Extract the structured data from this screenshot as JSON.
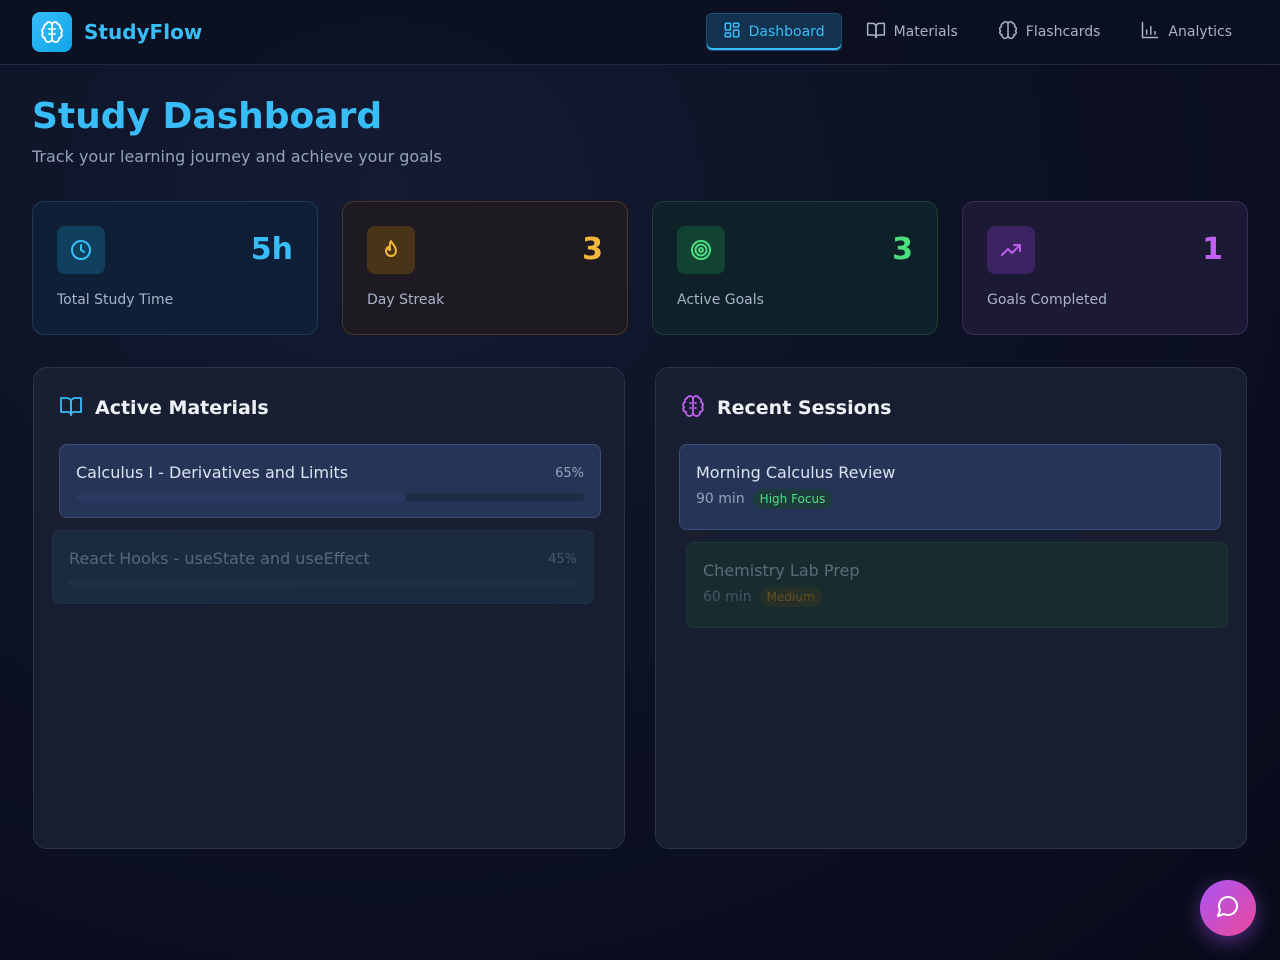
{
  "app": {
    "name": "StudyFlow",
    "logo_icon": "brain-icon",
    "accent": "#38bdf8"
  },
  "nav": {
    "items": [
      {
        "label": "Dashboard",
        "icon": "dashboard-icon",
        "active": true
      },
      {
        "label": "Materials",
        "icon": "book-icon",
        "active": false
      },
      {
        "label": "Flashcards",
        "icon": "brain-icon",
        "active": false
      },
      {
        "label": "Analytics",
        "icon": "bar-chart-icon",
        "active": false
      }
    ]
  },
  "page": {
    "title": "Study Dashboard",
    "subtitle": "Track your learning journey and achieve your goals"
  },
  "stats": [
    {
      "value": "5h",
      "label": "Total Study Time",
      "icon": "clock-icon",
      "color": "#38bdf8"
    },
    {
      "value": "3",
      "label": "Day Streak",
      "icon": "flame-icon",
      "color": "#f5b73a"
    },
    {
      "value": "3",
      "label": "Active Goals",
      "icon": "target-icon",
      "color": "#4ade80"
    },
    {
      "value": "1",
      "label": "Goals Completed",
      "icon": "trending-up-icon",
      "color": "#c060f0"
    }
  ],
  "materials": {
    "title": "Active Materials",
    "icon": "book-open-icon",
    "items": [
      {
        "name": "Calculus I - Derivatives and Limits",
        "percent_label": "65%",
        "progress": 0.65
      },
      {
        "name": "React Hooks - useState and useEffect",
        "percent_label": "45%",
        "progress": 0.45
      }
    ]
  },
  "sessions": {
    "title": "Recent Sessions",
    "icon": "brain-icon",
    "items": [
      {
        "name": "Morning Calculus Review",
        "duration": "90 min",
        "focus": "High Focus"
      },
      {
        "name": "Chemistry Lab Prep",
        "duration": "60 min",
        "focus": "Medium"
      }
    ]
  },
  "chat": {
    "icon": "chat-bubble-icon"
  }
}
